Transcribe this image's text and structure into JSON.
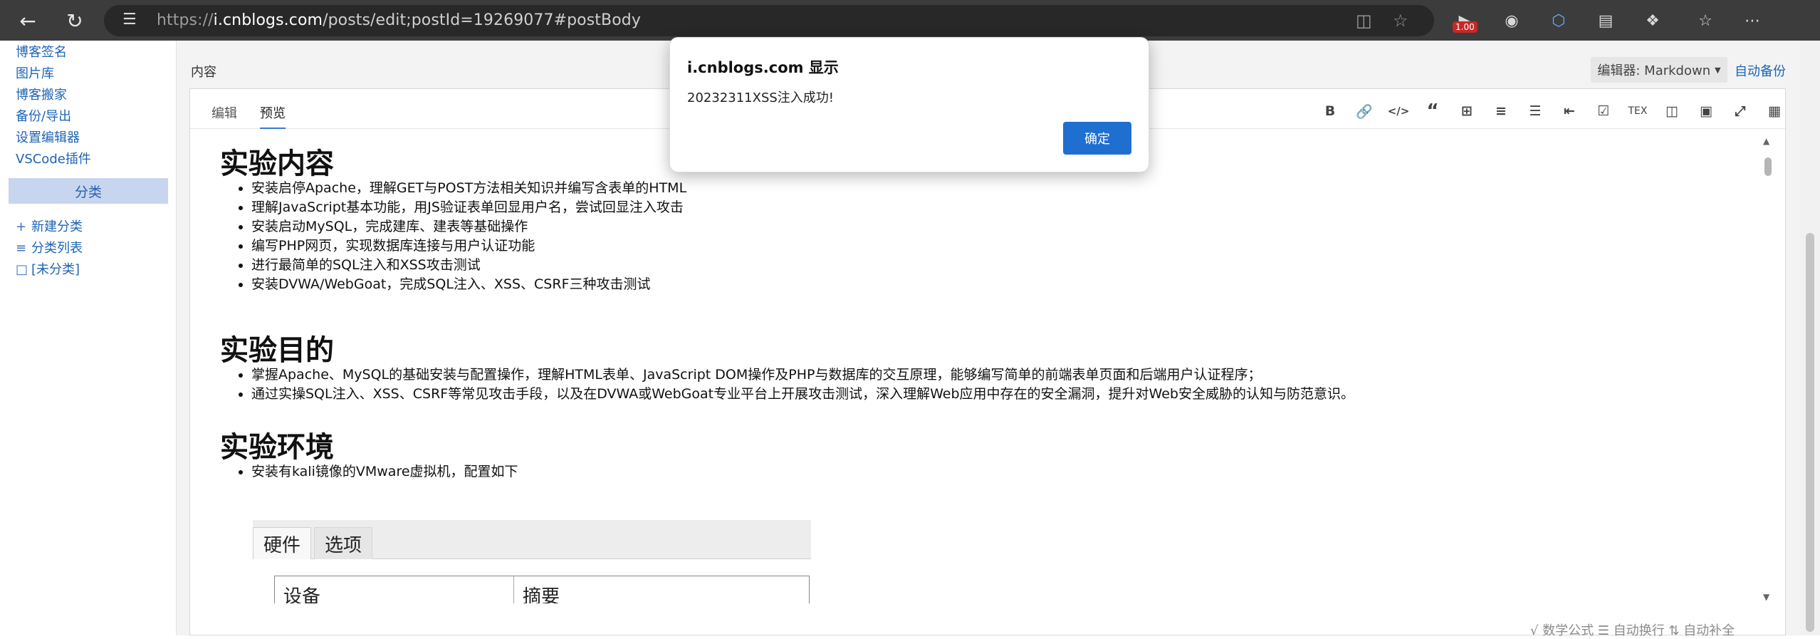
{
  "browser": {
    "url_prefix": "https://",
    "url_host": "i.cnblogs.com",
    "url_path": "/posts/edit;postId=19269077#postBody",
    "extension_badge": "1.00"
  },
  "sidebar": {
    "links": [
      "博客签名",
      "图片库",
      "博客搬家",
      "备份/导出",
      "设置编辑器",
      "VSCode插件"
    ],
    "category_header": "分类",
    "tools": [
      {
        "icon": "plus-icon",
        "label": "新建分类"
      },
      {
        "icon": "list-icon",
        "label": "分类列表"
      },
      {
        "icon": "folder-icon",
        "label": "[未分类]"
      }
    ]
  },
  "main": {
    "content_label": "内容",
    "editor_select": "编辑器: Markdown",
    "auto_backup": "自动备份",
    "tabs": [
      "编辑",
      "预览"
    ],
    "active_tab": "预览",
    "toolbar_icons": [
      "bold-icon",
      "link-icon",
      "code-icon",
      "quote-icon",
      "table-icon",
      "bullet-list-icon",
      "numbered-list-icon",
      "outdent-icon",
      "checkbox-icon",
      "tex-icon",
      "columns-icon",
      "save-icon",
      "fullscreen-icon",
      "image-icon"
    ],
    "toolbar_tex_label": "TEX"
  },
  "preview": {
    "sections": [
      {
        "heading": "实验内容",
        "items": [
          "安装启停Apache，理解GET与POST方法相关知识并编写含表单的HTML",
          "理解JavaScript基本功能，用JS验证表单回显用户名，尝试回显注入攻击",
          "安装启动MySQL，完成建库、建表等基础操作",
          "编写PHP网页，实现数据库连接与用户认证功能",
          "进行最简单的SQL注入和XSS攻击测试",
          "安装DVWA/WebGoat，完成SQL注入、XSS、CSRF三种攻击测试"
        ]
      },
      {
        "heading": "实验目的",
        "items": [
          "掌握Apache、MySQL的基础安装与配置操作，理解HTML表单、JavaScript DOM操作及PHP与数据库的交互原理，能够编写简单的前端表单页面和后端用户认证程序；",
          "通过实操SQL注入、XSS、CSRF等常见攻击手段，以及在DVWA或WebGoat专业平台上开展攻击测试，深入理解Web应用中存在的安全漏洞，提升对Web安全威胁的认知与防范意识。"
        ]
      },
      {
        "heading": "实验环境",
        "items": [
          "安装有kali镜像的VMware虚拟机，配置如下"
        ]
      }
    ],
    "vm_settings": {
      "tabs": [
        "硬件",
        "选项"
      ],
      "columns": [
        "设备",
        "摘要"
      ]
    }
  },
  "footer": {
    "text": "√ 数学公式  ☰ 自动换行  ⇅ 自动补全"
  },
  "dialog": {
    "title": "i.cnblogs.com 显示",
    "message": "20232311XSS注入成功!",
    "ok_label": "确定"
  },
  "colors": {
    "accent": "#1f6fd1",
    "link": "#1e64b4",
    "sidebar_category_bg": "#c7d6ee",
    "browser_bar": "#3c3c3c"
  }
}
